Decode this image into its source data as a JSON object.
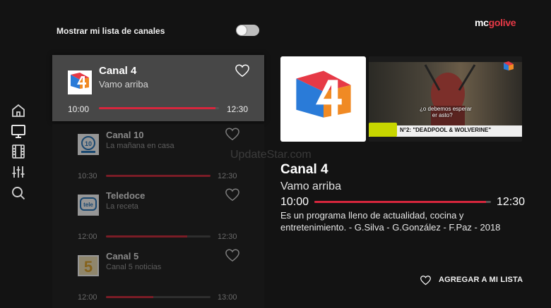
{
  "sidebar": {
    "items": [
      {
        "icon": "home-icon"
      },
      {
        "icon": "tv-icon"
      },
      {
        "icon": "film-icon"
      },
      {
        "icon": "sliders-icon"
      },
      {
        "icon": "search-icon"
      }
    ]
  },
  "toggle": {
    "label": "Mostrar mi lista de canales",
    "on": false
  },
  "brand": {
    "prefix": "mc",
    "suffix": "golive",
    "accent_color": "#e63946"
  },
  "channels": [
    {
      "name": "Canal 4",
      "program": "Vamo arriba",
      "start": "10:00",
      "end": "12:30",
      "progress": 0.97,
      "logo": "canal-4-logo"
    },
    {
      "name": "Canal 10",
      "program": "La mañana en casa",
      "start": "10:30",
      "end": "12:30",
      "progress": 1.0,
      "logo": "canal-10-logo"
    },
    {
      "name": "Teledoce",
      "program": "La receta",
      "start": "12:00",
      "end": "12:30",
      "progress": 0.78,
      "logo": "teledoce-logo"
    },
    {
      "name": "Canal 5",
      "program": "Canal 5 noticias",
      "start": "12:00",
      "end": "13:00",
      "progress": 0.45,
      "logo": "canal-5-logo"
    }
  ],
  "detail": {
    "title": "Canal 4",
    "program": "Vamo arriba",
    "start": "10:00",
    "end": "12:30",
    "progress": 0.97,
    "description": " Es un programa lleno de actualidad, cocina y\nentretenimiento. - G.Silva - G.González - F.Paz - 2018",
    "preview": {
      "caption": "¿o debemos esperar\n        er asto?",
      "ticker": "N°2: \"DEADPOOL & WOLVERINE\""
    }
  },
  "add_button": {
    "label": "AGREGAR A MI LISTA"
  },
  "watermark": "UpdateStar.com"
}
